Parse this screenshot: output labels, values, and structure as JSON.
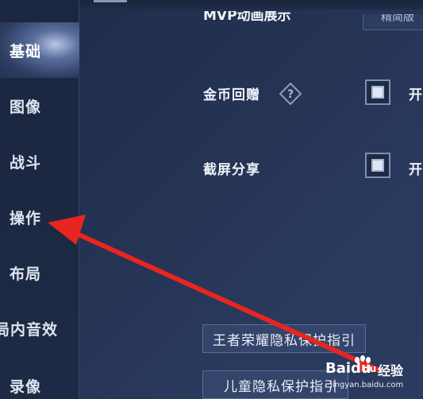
{
  "sidebar": {
    "items": [
      {
        "label": "基础",
        "active": true
      },
      {
        "label": "图像"
      },
      {
        "label": "战斗"
      },
      {
        "label": "操作"
      },
      {
        "label": "布局"
      },
      {
        "label": "局内音效"
      },
      {
        "label": "录像"
      }
    ]
  },
  "settings": {
    "partial_row_label": "MVP动画展示",
    "partial_row_value": "精简版",
    "coin_gift": {
      "label": "金币回赠",
      "option_label": "开",
      "checked": true
    },
    "screenshot_share": {
      "label": "截屏分享",
      "option_label": "开",
      "checked": true
    }
  },
  "buttons": {
    "privacy_guide": "王者荣耀隐私保护指引",
    "child_privacy_guide": "儿童隐私保护指引"
  },
  "watermark": {
    "brand": "Baidu",
    "brand_mark": "du",
    "product": "经验",
    "url": "jingyan.baidu.com"
  },
  "colors": {
    "arrow": "#e8251f",
    "accent": "#dfe6f3",
    "background": "#253354"
  }
}
